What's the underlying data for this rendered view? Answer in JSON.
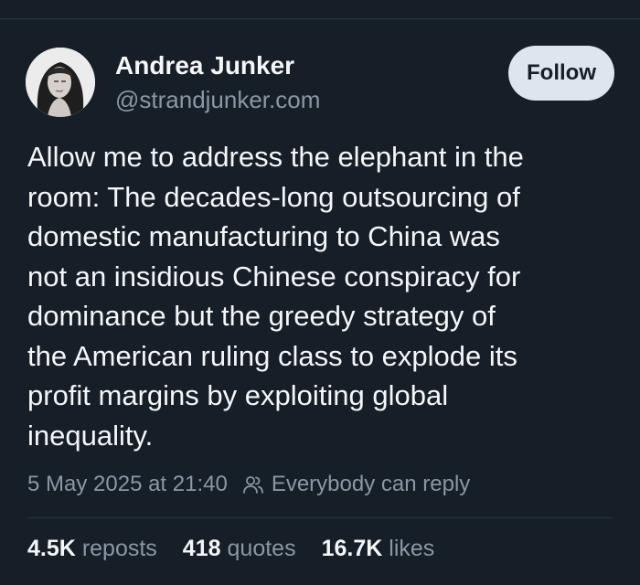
{
  "author": {
    "name": "Andrea Junker",
    "handle": "@strandjunker.com"
  },
  "follow_button": {
    "label": "Follow"
  },
  "post": {
    "lines": [
      "Allow me to address the elephant in the",
      "room: The decades-long outsourcing of",
      "domestic manufacturing to China was",
      "not an insidious Chinese conspiracy for",
      "dominance but the greedy strategy of",
      "the American ruling class to explode its",
      "profit margins by exploiting global",
      "inequality."
    ]
  },
  "meta": {
    "timestamp": "5 May 2025 at 21:40",
    "reply_setting": "Everybody can reply",
    "reply_icon": "people-icon"
  },
  "stats": [
    {
      "count": "4.5K",
      "label": "reposts"
    },
    {
      "count": "418",
      "label": "quotes"
    },
    {
      "count": "16.7K",
      "label": "likes"
    }
  ],
  "colors": {
    "background": "#161e27",
    "text": "#f4f6f8",
    "muted": "#8997a6",
    "button": "#dde5ee",
    "divider": "#2c3643"
  }
}
